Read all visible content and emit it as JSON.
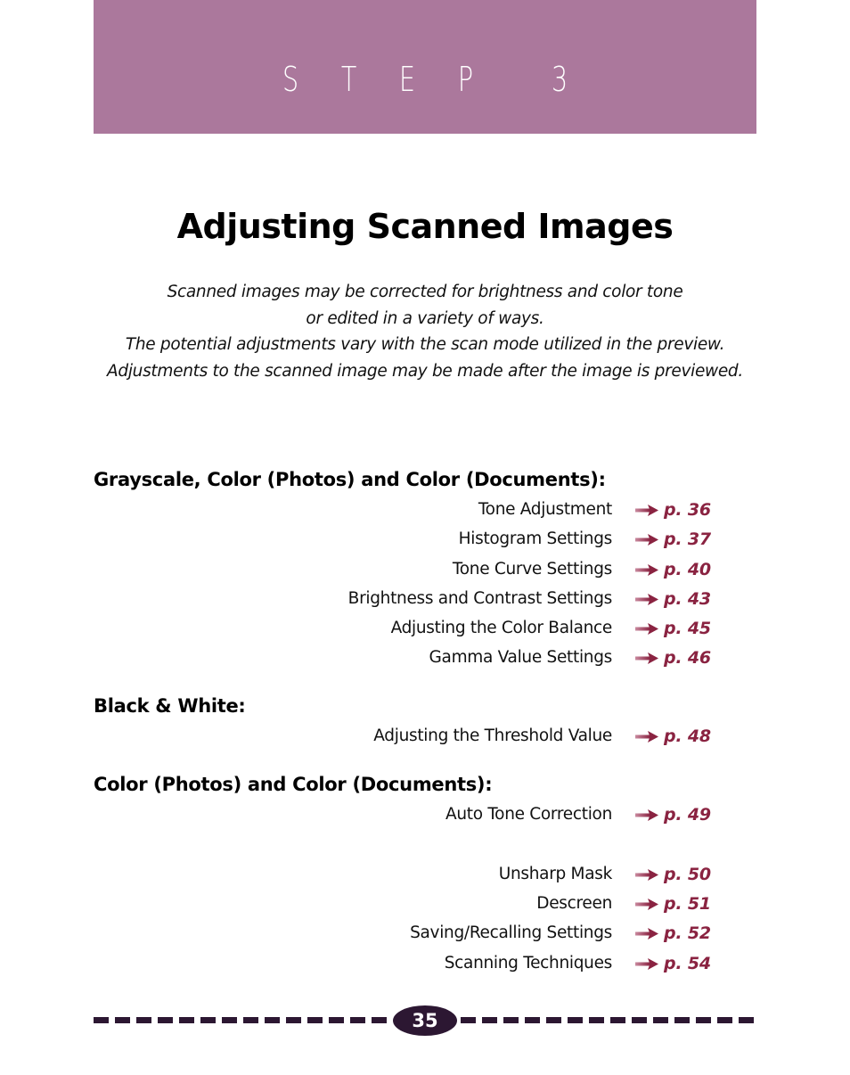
{
  "banner": {
    "step_letters": [
      "S",
      "T",
      "E",
      "P"
    ],
    "step_number": "3",
    "color": "#ab789c"
  },
  "title": "Adjusting Scanned Images",
  "intro": [
    "Scanned images may be corrected for brightness and color tone",
    "or edited in a variety of ways.",
    "The potential adjustments vary with the scan mode utilized in the preview.",
    "Adjustments to the scanned image may be made after the image is previewed."
  ],
  "sections": [
    {
      "heading": "Grayscale, Color (Photos) and Color (Documents):",
      "items": [
        {
          "label": "Tone Adjustment",
          "page": "p. 36"
        },
        {
          "label": "Histogram Settings",
          "page": "p. 37"
        },
        {
          "label": "Tone Curve Settings",
          "page": "p. 40"
        },
        {
          "label": "Brightness and Contrast Settings",
          "page": "p. 43"
        },
        {
          "label": "Adjusting the Color Balance",
          "page": "p. 45"
        },
        {
          "label": "Gamma Value Settings",
          "page": "p. 46"
        }
      ]
    },
    {
      "heading": "Black & White:",
      "items": [
        {
          "label": "Adjusting the Threshold Value",
          "page": "p. 48"
        }
      ]
    },
    {
      "heading": "Color (Photos) and Color (Documents):",
      "items": [
        {
          "label": "Auto Tone Correction",
          "page": "p. 49"
        }
      ]
    },
    {
      "heading": "",
      "items": [
        {
          "label": "Unsharp Mask",
          "page": "p. 50"
        },
        {
          "label": "Descreen",
          "page": "p. 51"
        },
        {
          "label": "Saving/Recalling Settings",
          "page": "p. 52"
        },
        {
          "label": "Scanning Techniques",
          "page": "p. 54"
        }
      ]
    }
  ],
  "arrow_icon": "right-arrow-icon",
  "accent_color": "#8a2341",
  "footer": {
    "page_number": "35",
    "rule_color": "#2c1732"
  }
}
